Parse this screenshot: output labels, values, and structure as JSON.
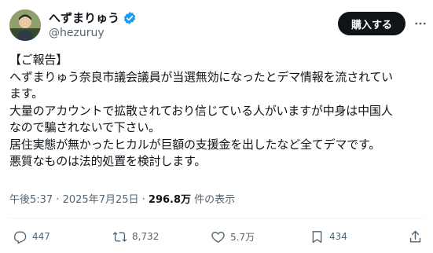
{
  "user": {
    "display_name": "へずまりゅう",
    "handle": "@hezuruy",
    "verified_color": "#1d9bf0"
  },
  "subscribe_label": "購入する",
  "more_icon": "more-horizontal-icon",
  "tweet": {
    "lines": [
      "【ご報告】",
      "へずまりゅう奈良市議会議員が当選無効になったとデマ情報を流されてい",
      "ます。",
      "大量のアカウントで拡散されており信じている人がいますが中身は中国人",
      "なので騙されないで下さい。",
      "居住実態が無かったヒカルが巨額の支援金を出したなど全てデマです。",
      "悪質なものは法的処置を検討します。"
    ]
  },
  "meta": {
    "time": "午後5:37",
    "separator": " · ",
    "date": "2025年7月25日",
    "views_count": "296.8万",
    "views_label": " 件の表示"
  },
  "actions": {
    "reply": {
      "icon": "reply-icon",
      "count": "447"
    },
    "retweet": {
      "icon": "retweet-icon",
      "count": "8,732"
    },
    "like": {
      "icon": "heart-icon",
      "count": "5.7万"
    },
    "bookmark": {
      "icon": "bookmark-icon",
      "count": "434"
    },
    "share": {
      "icon": "share-icon"
    }
  }
}
